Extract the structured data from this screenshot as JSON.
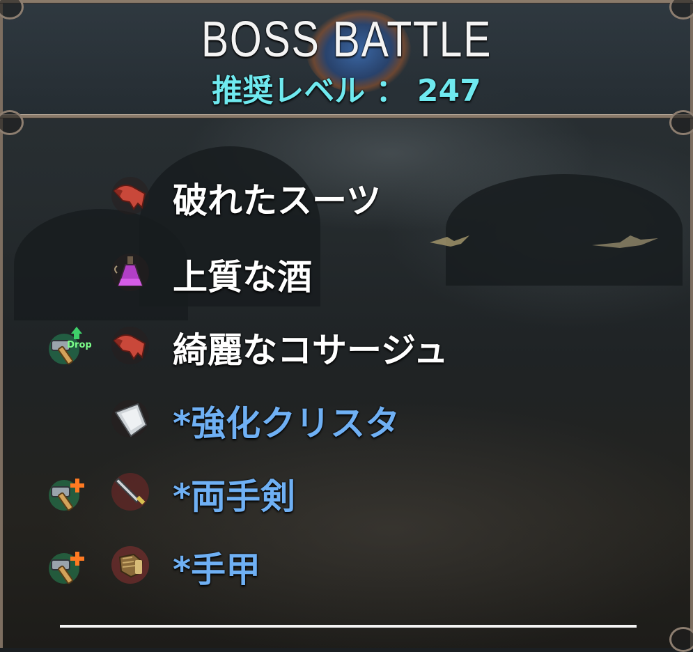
{
  "header": {
    "title": "BOSS  BATTLE",
    "recommended_level": "推奨レベル ： 247"
  },
  "items": [
    {
      "label": "破れたスーツ",
      "icon": "torn-cloth-icon",
      "badge": null,
      "rare": false
    },
    {
      "label": "上質な酒",
      "icon": "potion-flask-icon",
      "badge": null,
      "rare": false
    },
    {
      "label": "綺麗なコサージュ",
      "icon": "torn-cloth-icon",
      "badge": "hammer-drop-icon",
      "rare": false
    },
    {
      "label": "*強化クリスタ",
      "icon": "crystal-icon",
      "badge": null,
      "rare": true
    },
    {
      "label": "*両手剣",
      "icon": "sword-icon",
      "badge": "hammer-plus-icon",
      "rare": true
    },
    {
      "label": "*手甲",
      "icon": "gauntlet-icon",
      "badge": "hammer-plus-icon",
      "rare": true
    }
  ],
  "badge_text": "Drop",
  "colors": {
    "title": "#f4f4f4",
    "level": "#6fe9ef",
    "normal_item": "#ffffff",
    "rare_item": "#6fb0f4",
    "frame": "#8a7a6a"
  }
}
